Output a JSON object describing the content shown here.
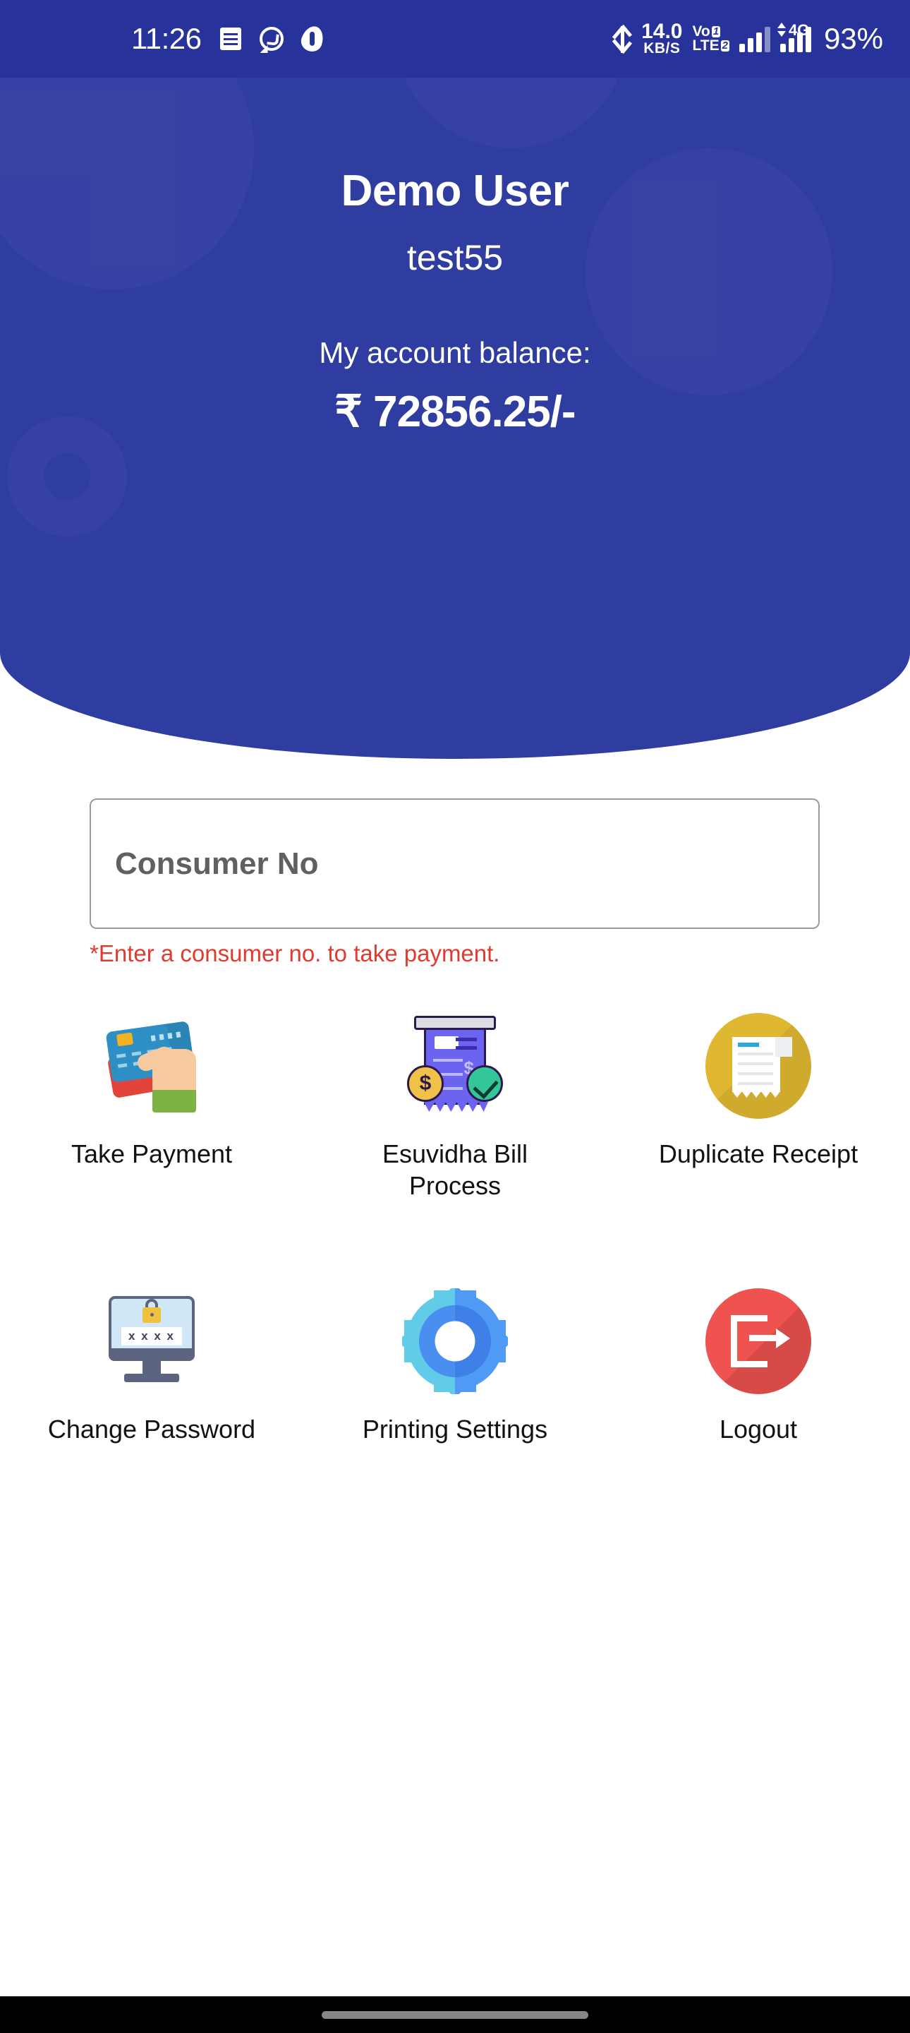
{
  "status_bar": {
    "time": "11:26",
    "icons_left": [
      "sms-icon",
      "whatsapp-icon",
      "airtel-icon"
    ],
    "bluetooth_icon": "bluetooth-icon",
    "net_speed_value": "14.0",
    "net_speed_unit": "KB/S",
    "volte_line1": "VoLTE",
    "volte_sim1": "1",
    "volte_sim2": "2",
    "network_type": "4G",
    "battery": "93%",
    "background_color": "#27339a"
  },
  "header": {
    "user_name": "Demo User",
    "login_id": "test55",
    "balance_label": "My account balance:",
    "balance_amount": "₹ 72856.25/-",
    "background_color": "#2f3ca0"
  },
  "form": {
    "consumer_no_value": "",
    "consumer_no_placeholder": "Consumer No",
    "error_text": "*Enter a consumer no. to take payment.",
    "error_color": "#e03b2f"
  },
  "menu": {
    "rows": [
      [
        {
          "label": "Take Payment",
          "icon": "credit-card-hand-icon"
        },
        {
          "label": "Esuvidha Bill Process",
          "icon": "receipt-bill-icon"
        },
        {
          "label": "Duplicate Receipt",
          "icon": "duplicate-receipt-icon"
        }
      ],
      [
        {
          "label": "Change Password",
          "icon": "monitor-lock-icon"
        },
        {
          "label": "Printing Settings",
          "icon": "gear-icon"
        },
        {
          "label": "Logout",
          "icon": "logout-icon"
        }
      ]
    ]
  },
  "nav_bar": {
    "gesture_pill": "home-gesture-pill"
  }
}
